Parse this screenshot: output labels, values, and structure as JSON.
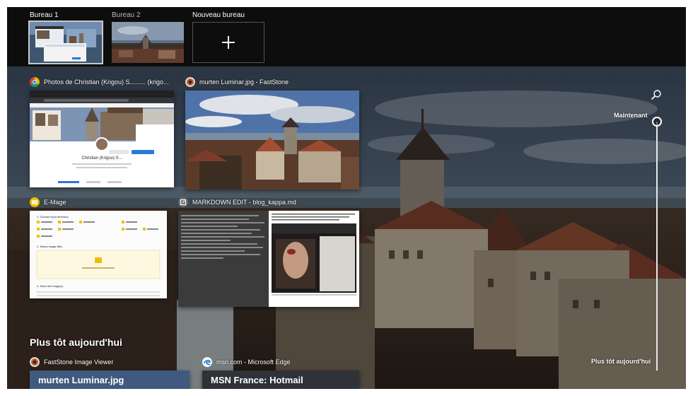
{
  "desktops": [
    {
      "label": "Bureau 1",
      "active": true
    },
    {
      "label": "Bureau 2",
      "active": false
    }
  ],
  "new_desktop_label": "Nouveau bureau",
  "windows": {
    "chrome": {
      "title": "Photos de Christian (Krigou) S......... (krigo...",
      "icon": "chrome-icon",
      "profile_name": "Christian (Krigou) S..."
    },
    "faststone": {
      "title": "murten Luminar.jpg - FastStone",
      "icon": "faststone-icon"
    },
    "emage": {
      "title": "E-Mage",
      "icon": "emage-icon",
      "step1": "1. Choose input directory",
      "step2": "2. Select image files",
      "step3": "3. Save the image(s)"
    },
    "markdown": {
      "title": "MARKDOWN EDIT - blog_kappa.md",
      "icon": "markdown-edit-icon"
    }
  },
  "earlier_section": {
    "title": "Plus tôt aujourd'hui",
    "items": [
      {
        "title": "FastStone Image Viewer",
        "preview_text": "murten Luminar.jpg",
        "icon": "faststone-icon"
      },
      {
        "title": "msn.com - Microsoft Edge",
        "preview_text": "MSN France: Hotmail",
        "icon": "edge-icon"
      }
    ]
  },
  "timeline": {
    "now_label": "Maintenant",
    "earlier_label": "Plus tôt aujourd'hui"
  },
  "colors": {
    "background": "#0b0b0c",
    "accent_blue": "#2b79d8",
    "tile_shadow": "#000000"
  }
}
